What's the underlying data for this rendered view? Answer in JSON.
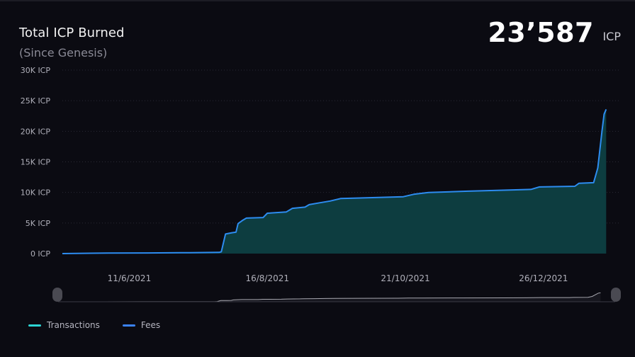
{
  "header": {
    "title": "Total ICP Burned",
    "subtitle": "(Since Genesis)",
    "total_value": "23’587",
    "total_unit": "ICP"
  },
  "legend": [
    {
      "label": "Transactions",
      "color": "#2dd4d4"
    },
    {
      "label": "Fees",
      "color": "#3b82f6"
    }
  ],
  "colors": {
    "background": "#0b0b12",
    "fees_line": "#2d8cf0",
    "area_fill": "#0d3d40",
    "grid": "#2a2a36",
    "axis_text": "#b0b0ba",
    "navigator_line": "#a8a8b0",
    "navigator_handle": "#4a4a52"
  },
  "chart_data": {
    "type": "area",
    "ylim": [
      0,
      30000
    ],
    "y_ticks": [
      {
        "value": 0,
        "label": "0 ICP"
      },
      {
        "value": 5000,
        "label": "5K ICP"
      },
      {
        "value": 10000,
        "label": "10K ICP"
      },
      {
        "value": 15000,
        "label": "15K ICP"
      },
      {
        "value": 20000,
        "label": "20K ICP"
      },
      {
        "value": 25000,
        "label": "25K ICP"
      },
      {
        "value": 30000,
        "label": "30K ICP"
      }
    ],
    "x_range": [
      "2021-05-10",
      "2022-02-01"
    ],
    "x_ticks": [
      {
        "date": "2021-06-11",
        "label": "11/6/2021"
      },
      {
        "date": "2021-08-16",
        "label": "16/8/2021"
      },
      {
        "date": "2021-10-21",
        "label": "21/10/2021"
      },
      {
        "date": "2021-12-26",
        "label": "26/12/2021"
      }
    ],
    "grid": true,
    "series": [
      {
        "name": "Fees",
        "points": [
          [
            "2021-05-10",
            0
          ],
          [
            "2021-05-20",
            50
          ],
          [
            "2021-06-01",
            80
          ],
          [
            "2021-06-20",
            100
          ],
          [
            "2021-07-10",
            150
          ],
          [
            "2021-07-24",
            200
          ],
          [
            "2021-07-25",
            300
          ],
          [
            "2021-07-27",
            3200
          ],
          [
            "2021-07-30",
            3400
          ],
          [
            "2021-08-01",
            3500
          ],
          [
            "2021-08-02",
            4900
          ],
          [
            "2021-08-04",
            5400
          ],
          [
            "2021-08-06",
            5800
          ],
          [
            "2021-08-14",
            5900
          ],
          [
            "2021-08-16",
            6600
          ],
          [
            "2021-08-25",
            6800
          ],
          [
            "2021-08-28",
            7400
          ],
          [
            "2021-09-03",
            7600
          ],
          [
            "2021-09-05",
            8000
          ],
          [
            "2021-09-10",
            8300
          ],
          [
            "2021-09-15",
            8600
          ],
          [
            "2021-09-20",
            9000
          ],
          [
            "2021-10-20",
            9300
          ],
          [
            "2021-10-25",
            9700
          ],
          [
            "2021-11-01",
            10000
          ],
          [
            "2021-11-20",
            10200
          ],
          [
            "2021-12-10",
            10400
          ],
          [
            "2021-12-20",
            10500
          ],
          [
            "2021-12-24",
            10900
          ],
          [
            "2022-01-10",
            11000
          ],
          [
            "2022-01-12",
            11500
          ],
          [
            "2022-01-19",
            11600
          ],
          [
            "2022-01-21",
            14000
          ],
          [
            "2022-01-23",
            20000
          ],
          [
            "2022-01-24",
            22800
          ],
          [
            "2022-01-25",
            23587
          ]
        ]
      }
    ]
  }
}
